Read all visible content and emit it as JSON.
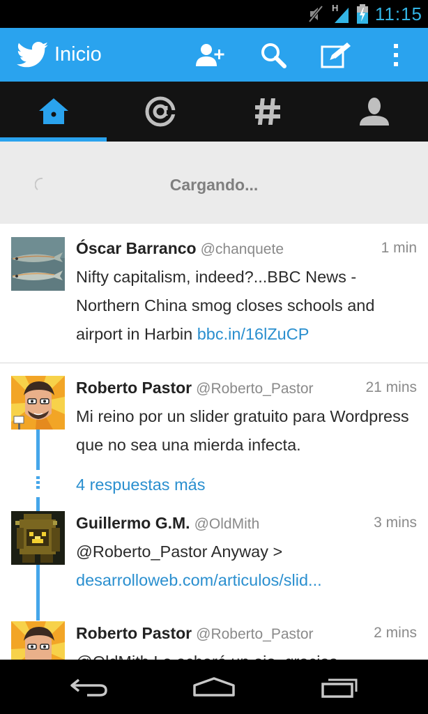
{
  "status_bar": {
    "time": "11:15",
    "network_label": "H",
    "icons": [
      "mute-icon",
      "signal-icon",
      "battery-charging-icon"
    ]
  },
  "action_bar": {
    "title": "Inicio",
    "icons": [
      "twitter-bird-icon",
      "add-user-icon",
      "search-icon",
      "compose-icon",
      "overflow-menu-icon"
    ],
    "accent": "#2aa3ee"
  },
  "tabs": [
    {
      "name": "home",
      "icon": "home-icon",
      "selected": true
    },
    {
      "name": "mentions",
      "icon": "at-icon",
      "selected": false
    },
    {
      "name": "discover",
      "icon": "hashtag-icon",
      "selected": false
    },
    {
      "name": "profile",
      "icon": "person-icon",
      "selected": false
    }
  ],
  "loading": {
    "text": "Cargando..."
  },
  "tweets": [
    {
      "author": "Óscar Barranco",
      "handle": "@chanquete",
      "time": "1 min",
      "text": "Nifty capitalism, indeed?...BBC News - Northern China smog closes schools and airport in Harbin",
      "link": "bbc.in/16lZuCP"
    },
    {
      "author": "Roberto Pastor",
      "handle": "@Roberto_Pastor",
      "time": "21 mins",
      "text": "Mi reino por un slider gratuito para Wordpress que no sea una mierda infecta."
    },
    {
      "more_replies": "4 respuestas más"
    },
    {
      "author": "Guillermo G.M.",
      "handle": "@OldMith",
      "time": "3 mins",
      "text": "@Roberto_Pastor Anyway >",
      "link": "desarrolloweb.com/articulos/slid..."
    },
    {
      "author": "Roberto Pastor",
      "handle": "@Roberto_Pastor",
      "time": "2 mins",
      "text": "@OldMith Le echaré un ojo, gracias"
    }
  ],
  "nav_bar": {
    "icons": [
      "back-icon",
      "home-nav-icon",
      "recent-apps-icon"
    ]
  }
}
